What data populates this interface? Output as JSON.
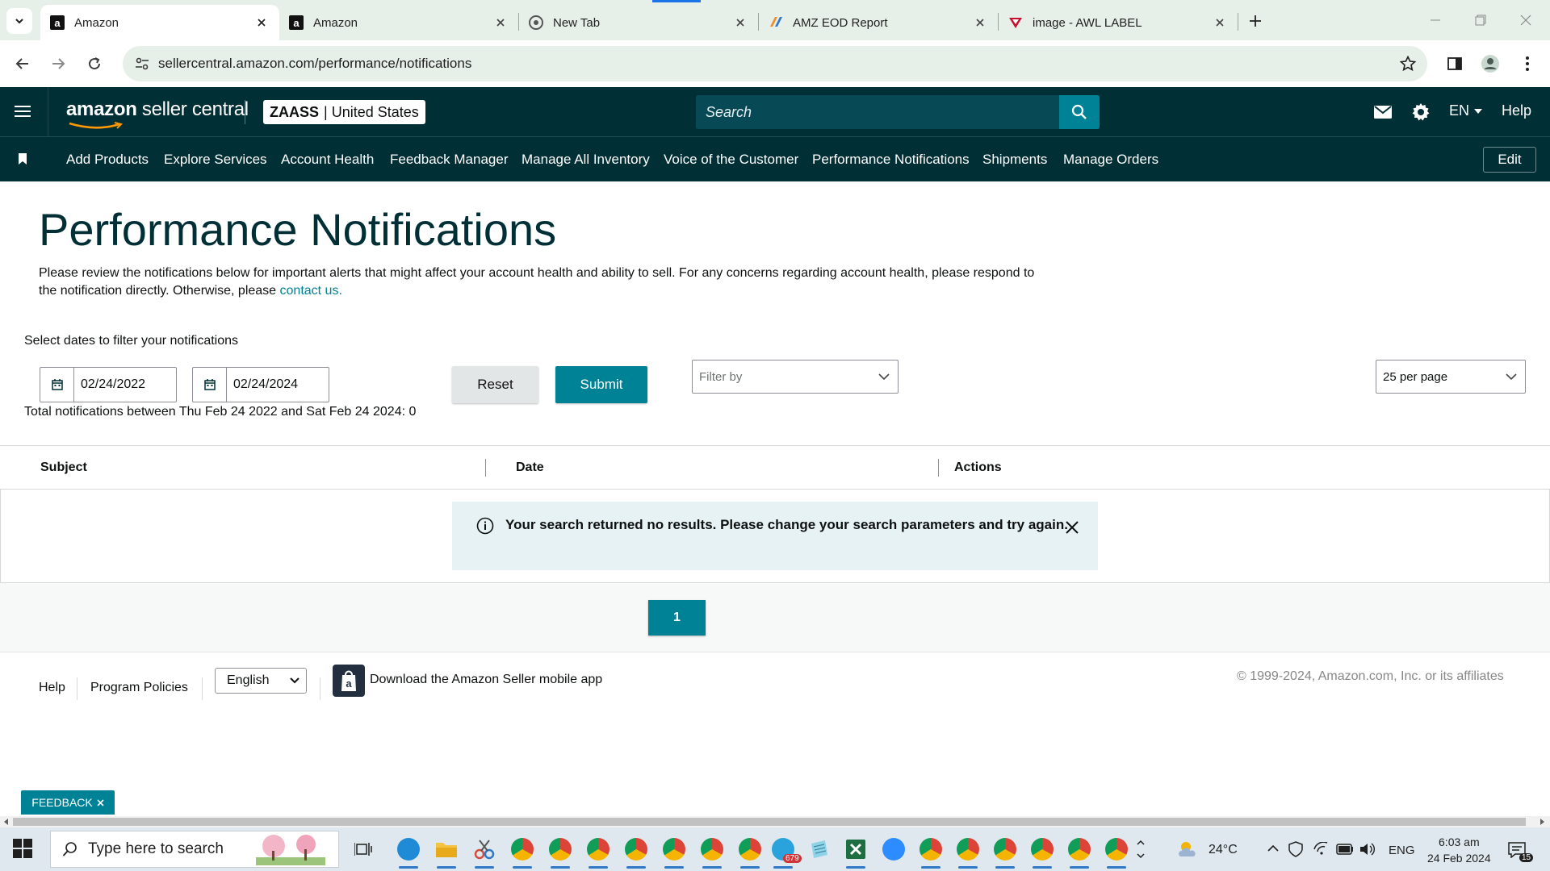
{
  "browser": {
    "tabs": [
      {
        "title": "Amazon",
        "favicon": "amazon-icon",
        "active": true
      },
      {
        "title": "Amazon",
        "favicon": "amazon-icon",
        "active": false
      },
      {
        "title": "New Tab",
        "favicon": "chrome-icon",
        "active": false
      },
      {
        "title": "AMZ EOD Report",
        "favicon": "report-icon",
        "active": false
      },
      {
        "title": "image - AWL LABEL",
        "favicon": "awl-icon",
        "active": false
      }
    ],
    "url": "sellercentral.amazon.com/performance/notifications"
  },
  "header": {
    "logo_bold": "amazon",
    "logo_rest": " seller central",
    "store_name": "ZAASS",
    "store_region": "| United States",
    "search_placeholder": "Search",
    "language": "EN",
    "help": "Help"
  },
  "nav": {
    "items": [
      "Add Products",
      "Explore Services",
      "Account Health",
      "Feedback Manager",
      "Manage All Inventory",
      "Voice of the Customer",
      "Performance Notifications",
      "Shipments",
      "Manage Orders"
    ],
    "edit_label": "Edit"
  },
  "page": {
    "title": "Performance Notifications",
    "description": "Please review the notifications below for important alerts that might affect your account health and ability to sell. For any concerns regarding account health, please respond to the notification directly. Otherwise, please ",
    "contact_link": "contact us.",
    "filter_label": "Select dates to filter your notifications",
    "start_date": "02/24/2022",
    "end_date": "02/24/2024",
    "reset_label": "Reset",
    "submit_label": "Submit",
    "filter_by_placeholder": "Filter by",
    "per_page": "25 per page",
    "total_line": "Total notifications between Thu Feb 24 2022 and Sat Feb 24 2024: 0"
  },
  "table": {
    "columns": [
      "Subject",
      "Date",
      "Actions"
    ],
    "empty_message": "Your search returned no results. Please change your search parameters and try again."
  },
  "pagination": {
    "current_page": "1"
  },
  "footer": {
    "help": "Help",
    "program_policies": "Program Policies",
    "language": "English",
    "app_download": "Download the Amazon Seller mobile app",
    "copyright": "© 1999-2024, Amazon.com, Inc. or its affiliates"
  },
  "feedback_label": "FEEDBACK",
  "taskbar": {
    "search_placeholder": "Type here to search",
    "weather": "24°C",
    "input_lang": "ENG",
    "time": "6:03 am",
    "date": "24 Feb 2024",
    "telegram_badge": "679",
    "notification_count": "15"
  },
  "colors": {
    "header_bg": "#002f36",
    "accent_teal": "#008296",
    "title_color": "#002f36",
    "alert_bg": "#e6f2f3",
    "tab_strip_bg": "#e7efe9"
  }
}
